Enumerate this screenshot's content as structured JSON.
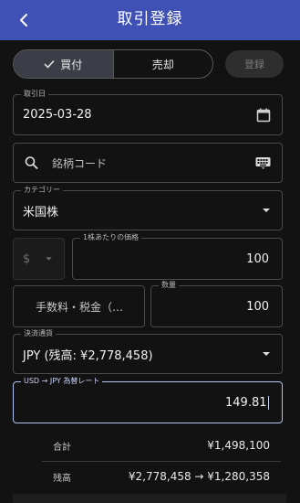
{
  "appbar": {
    "title": "取引登録"
  },
  "trade_type": {
    "buy_label": "買付",
    "sell_label": "売却",
    "selected": "buy"
  },
  "register_label": "登録",
  "trade_date": {
    "label": "取引日",
    "value": "2025-03-28"
  },
  "symbol": {
    "placeholder": "銘柄コード"
  },
  "category": {
    "label": "カテゴリー",
    "value": "米国株"
  },
  "currency_symbol": "$",
  "price": {
    "label": "1株あたりの価格",
    "value": "100"
  },
  "fees": {
    "label": "手数料・税金（…"
  },
  "quantity": {
    "label": "数量",
    "value": "100"
  },
  "settlement": {
    "label": "決済通貨",
    "value": "JPY (残高: ¥2,778,458)"
  },
  "fx_rate": {
    "label": "USD → JPY 為替レート",
    "value": "149.81"
  },
  "summary": {
    "total_label": "合計",
    "total_value": "¥1,498,100",
    "balance_label": "残高",
    "balance_value": "¥2,778,458 → ¥1,280,358"
  },
  "colors": {
    "appbar": "#3f51b5",
    "background": "#121212",
    "focus_border": "#b3c0f2"
  }
}
